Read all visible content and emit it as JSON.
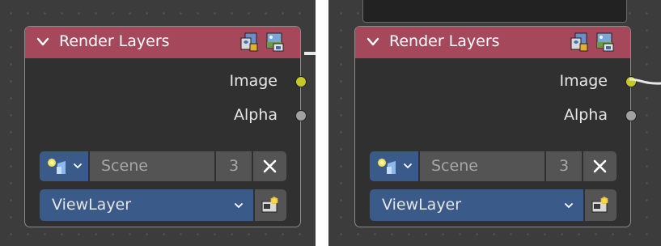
{
  "node": {
    "title": "Render Layers",
    "header_color": "#a5485b",
    "outputs": [
      {
        "label": "Image",
        "socket_color": "#c7c729",
        "linked": true
      },
      {
        "label": "Alpha",
        "socket_color": "#a1a1a1",
        "linked": false
      }
    ],
    "scene": {
      "name": "Scene",
      "user_count": "3"
    },
    "view_layer": {
      "name": "ViewLayer"
    }
  },
  "icons": {
    "collapse": "chevron-down-icon",
    "header": [
      "image-editor-icon",
      "render-result-icon"
    ],
    "scene_type": "scene-data-icon",
    "unlink": "close-icon",
    "render": "render-camera-icon"
  }
}
